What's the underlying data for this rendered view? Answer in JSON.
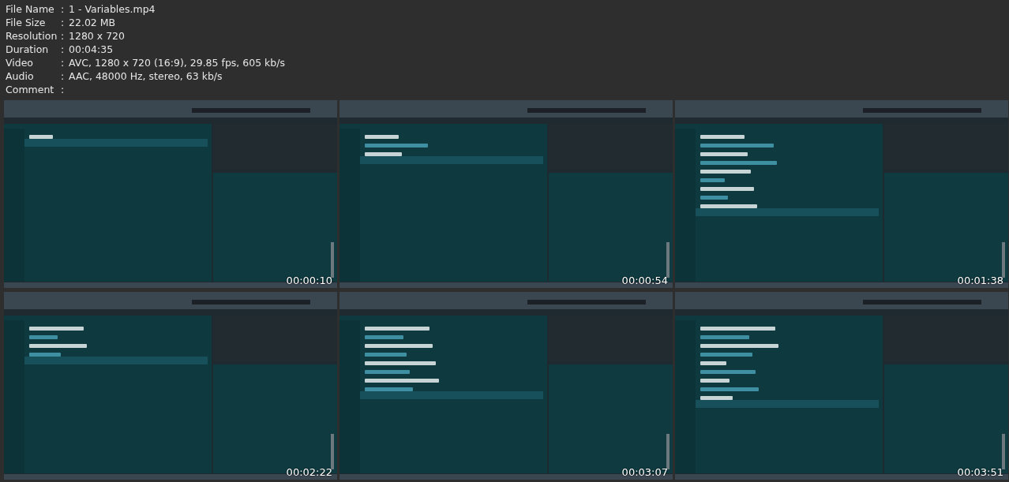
{
  "info": [
    {
      "label": "File Name",
      "colon": ":",
      "value": "1 - Variables.mp4"
    },
    {
      "label": "File Size",
      "colon": ":",
      "value": "22.02 MB"
    },
    {
      "label": "Resolution",
      "colon": ":",
      "value": "1280 x 720"
    },
    {
      "label": "Duration",
      "colon": ":",
      "value": "00:04:35"
    },
    {
      "label": "Video",
      "colon": ":",
      "value": "AVC, 1280 x 720 (16:9), 29.85 fps, 605 kb/s"
    },
    {
      "label": "Audio",
      "colon": ":",
      "value": "AAC, 48000 Hz, stereo, 63 kb/s"
    },
    {
      "label": "Comment",
      "colon": ":"
    }
  ],
  "thumbnails": [
    {
      "kind": "picture",
      "timestamp": "00:00:10"
    },
    {
      "kind": "picture",
      "timestamp": "00:00:54"
    },
    {
      "kind": "picture",
      "timestamp": "00:01:38"
    },
    {
      "kind": "picture",
      "timestamp": "00:02:22"
    },
    {
      "kind": "picture",
      "timestamp": "00:03:07"
    },
    {
      "kind": "picture",
      "timestamp": "00:03:51"
    }
  ]
}
